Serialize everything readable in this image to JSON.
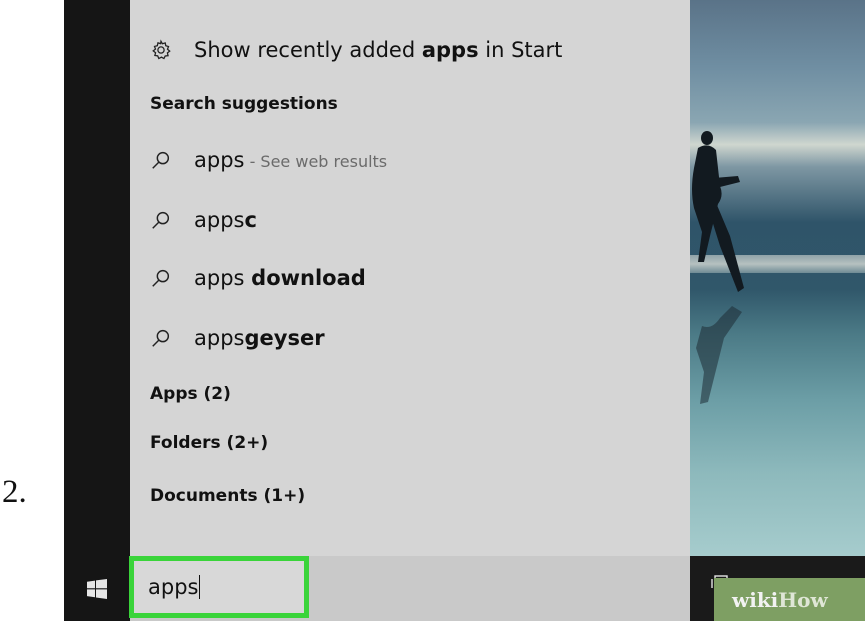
{
  "step": {
    "number": "2."
  },
  "top_item": {
    "label_prefix": "Show recently added ",
    "label_bold": "apps",
    "label_suffix": " in Start",
    "icon": "gear-icon"
  },
  "search_suggestions": {
    "heading": "Search suggestions",
    "items": [
      {
        "text": "apps",
        "bold": "",
        "note": " - See web results"
      },
      {
        "text": "apps",
        "bold": "c",
        "note": ""
      },
      {
        "text": "apps ",
        "bold": "download",
        "note": ""
      },
      {
        "text": "apps",
        "bold": "geyser",
        "note": ""
      }
    ],
    "icon": "search-icon"
  },
  "sections": [
    {
      "label": "Apps (2)"
    },
    {
      "label": "Folders (2+)"
    },
    {
      "label": "Documents (1+)"
    }
  ],
  "taskbar": {
    "start_icon": "windows-logo-icon",
    "search_value": "apps"
  },
  "watermark": {
    "wiki": "wiki",
    "how": "How"
  }
}
